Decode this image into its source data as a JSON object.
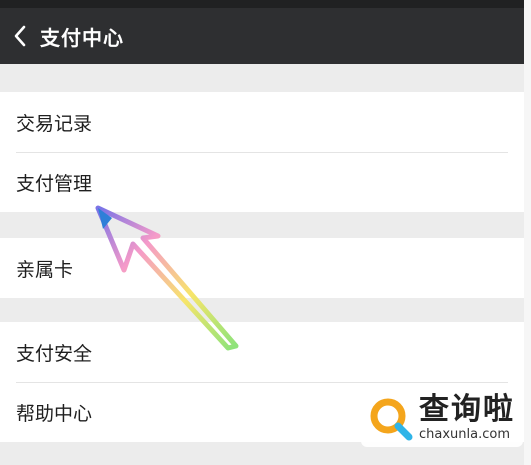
{
  "header": {
    "title": "支付中心",
    "back_icon": "chevron-left-icon"
  },
  "groups": [
    {
      "items": [
        "交易记录",
        "支付管理"
      ]
    },
    {
      "items": [
        "亲属卡"
      ]
    },
    {
      "items": [
        "支付安全",
        "帮助中心"
      ]
    }
  ],
  "watermark": {
    "text": "查询啦",
    "domain": "chaxunla.com"
  },
  "colors": {
    "header_bg": "#2e2f31",
    "page_bg": "#ececec",
    "row_bg": "#ffffff"
  }
}
